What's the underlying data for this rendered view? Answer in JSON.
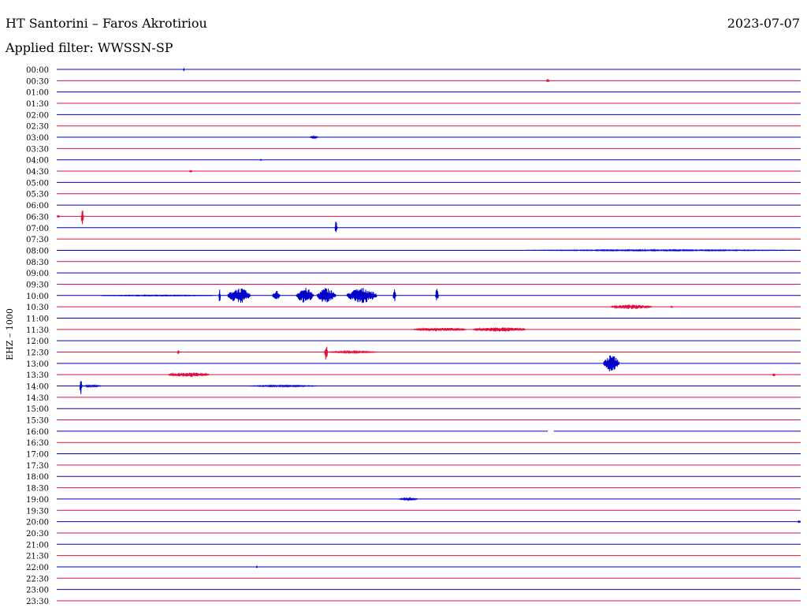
{
  "header": {
    "station": "HT Santorini – Faros Akrotiriou",
    "date": "2023-07-07",
    "filter": "Applied filter: WWSSN-SP"
  },
  "chart_data": {
    "type": "line",
    "ylabel": "EHZ – 1000",
    "line_colors": [
      "#0000cc",
      "#e0103c"
    ],
    "row_labels": [
      "00:00",
      "00:30",
      "01:00",
      "01:30",
      "02:00",
      "02:30",
      "03:00",
      "03:30",
      "04:00",
      "04:30",
      "05:00",
      "05:30",
      "06:00",
      "06:30",
      "07:00",
      "07:30",
      "08:00",
      "08:30",
      "09:00",
      "09:30",
      "10:00",
      "10:30",
      "11:00",
      "11:30",
      "12:00",
      "12:30",
      "13:00",
      "13:30",
      "14:00",
      "14:30",
      "15:00",
      "15:30",
      "16:00",
      "16:30",
      "17:00",
      "17:30",
      "18:00",
      "18:30",
      "19:00",
      "19:30",
      "20:00",
      "20:30",
      "21:00",
      "21:30",
      "22:00",
      "22:30",
      "23:00",
      "23:30"
    ],
    "grid": false,
    "events": [
      {
        "row": 0,
        "start": 0.17,
        "end": 0.172,
        "amp": 0.15
      },
      {
        "row": 1,
        "start": 0.658,
        "end": 0.662,
        "amp": 0.15
      },
      {
        "row": 6,
        "start": 0.34,
        "end": 0.352,
        "amp": 0.1
      },
      {
        "row": 8,
        "start": 0.273,
        "end": 0.276,
        "amp": 0.05
      },
      {
        "row": 9,
        "start": 0.178,
        "end": 0.182,
        "amp": 0.1
      },
      {
        "row": 13,
        "start": 0.0,
        "end": 0.004,
        "amp": 0.1
      },
      {
        "row": 13,
        "start": 0.033,
        "end": 0.036,
        "amp": 1.0
      },
      {
        "row": 14,
        "start": 0.374,
        "end": 0.377,
        "amp": 0.8
      },
      {
        "row": 16,
        "start": 0.63,
        "end": 1.0,
        "amp": 0.06
      },
      {
        "row": 20,
        "start": 0.06,
        "end": 0.21,
        "amp": 0.05
      },
      {
        "row": 20,
        "start": 0.218,
        "end": 0.22,
        "amp": 1.0
      },
      {
        "row": 20,
        "start": 0.23,
        "end": 0.26,
        "amp": 0.9
      },
      {
        "row": 20,
        "start": 0.29,
        "end": 0.3,
        "amp": 0.6
      },
      {
        "row": 20,
        "start": 0.322,
        "end": 0.345,
        "amp": 0.9
      },
      {
        "row": 20,
        "start": 0.35,
        "end": 0.375,
        "amp": 0.9
      },
      {
        "row": 20,
        "start": 0.39,
        "end": 0.43,
        "amp": 0.9
      },
      {
        "row": 20,
        "start": 0.452,
        "end": 0.456,
        "amp": 0.8
      },
      {
        "row": 20,
        "start": 0.509,
        "end": 0.513,
        "amp": 0.8
      },
      {
        "row": 21,
        "start": 0.745,
        "end": 0.8,
        "amp": 0.25
      },
      {
        "row": 21,
        "start": 0.825,
        "end": 0.828,
        "amp": 0.1
      },
      {
        "row": 23,
        "start": 0.48,
        "end": 0.55,
        "amp": 0.2
      },
      {
        "row": 23,
        "start": 0.56,
        "end": 0.63,
        "amp": 0.25
      },
      {
        "row": 25,
        "start": 0.162,
        "end": 0.165,
        "amp": 0.2
      },
      {
        "row": 25,
        "start": 0.36,
        "end": 0.364,
        "amp": 1.0
      },
      {
        "row": 25,
        "start": 0.364,
        "end": 0.43,
        "amp": 0.1
      },
      {
        "row": 26,
        "start": 0.735,
        "end": 0.756,
        "amp": 1.0
      },
      {
        "row": 27,
        "start": 0.15,
        "end": 0.205,
        "amp": 0.25
      },
      {
        "row": 27,
        "start": 0.962,
        "end": 0.966,
        "amp": 0.15
      },
      {
        "row": 28,
        "start": 0.031,
        "end": 0.034,
        "amp": 1.0
      },
      {
        "row": 28,
        "start": 0.034,
        "end": 0.06,
        "amp": 0.1
      },
      {
        "row": 28,
        "start": 0.26,
        "end": 0.35,
        "amp": 0.08
      },
      {
        "row": 38,
        "start": 0.46,
        "end": 0.485,
        "amp": 0.12
      },
      {
        "row": 40,
        "start": 0.996,
        "end": 1.0,
        "amp": 0.1
      },
      {
        "row": 44,
        "start": 0.268,
        "end": 0.27,
        "amp": 0.1
      }
    ],
    "gaps": [
      {
        "row": 32,
        "start": 0.66,
        "end": 0.668
      }
    ]
  }
}
